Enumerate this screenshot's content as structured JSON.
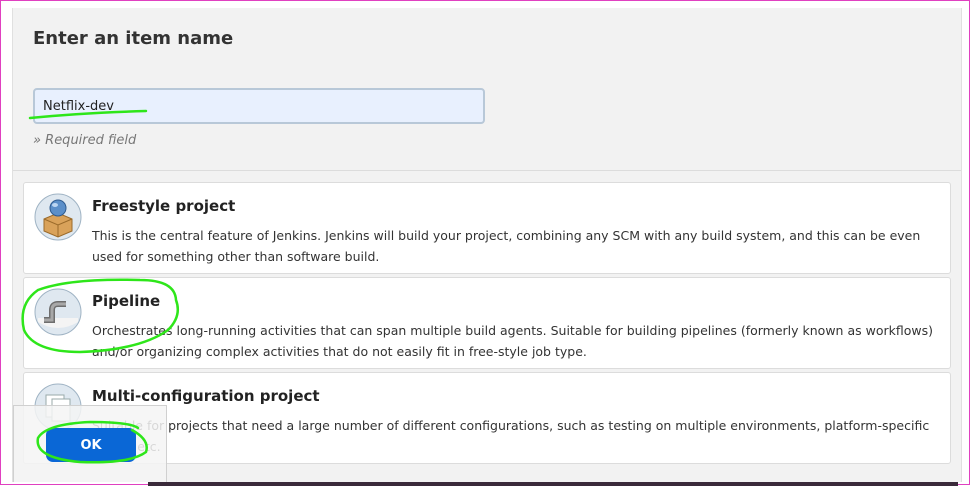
{
  "header": {
    "title": "Enter an item name",
    "name_value": "Netflix-dev",
    "required_text": "» Required field"
  },
  "items": [
    {
      "title": "Freestyle project",
      "description": "This is the central feature of Jenkins. Jenkins will build your project, combining any SCM with any build system, and this can be even used for something other than software build.",
      "icon": "freestyle-project-icon"
    },
    {
      "title": "Pipeline",
      "description": "Orchestrates long-running activities that can span multiple build agents. Suitable for building pipelines (formerly known as workflows) and/or organizing complex activities that do not easily fit in free-style job type.",
      "icon": "pipeline-icon"
    },
    {
      "title": "Multi-configuration project",
      "description": "Suitable for projects that need a large number of different configurations, such as testing on multiple environments, platform-specific builds, etc.",
      "icon": "multi-configuration-icon"
    }
  ],
  "footer": {
    "ok_label": "OK"
  },
  "colors": {
    "ok_button": "#0a67d6",
    "annotation": "#2ee61a",
    "input_bg": "#e8f0fe"
  }
}
